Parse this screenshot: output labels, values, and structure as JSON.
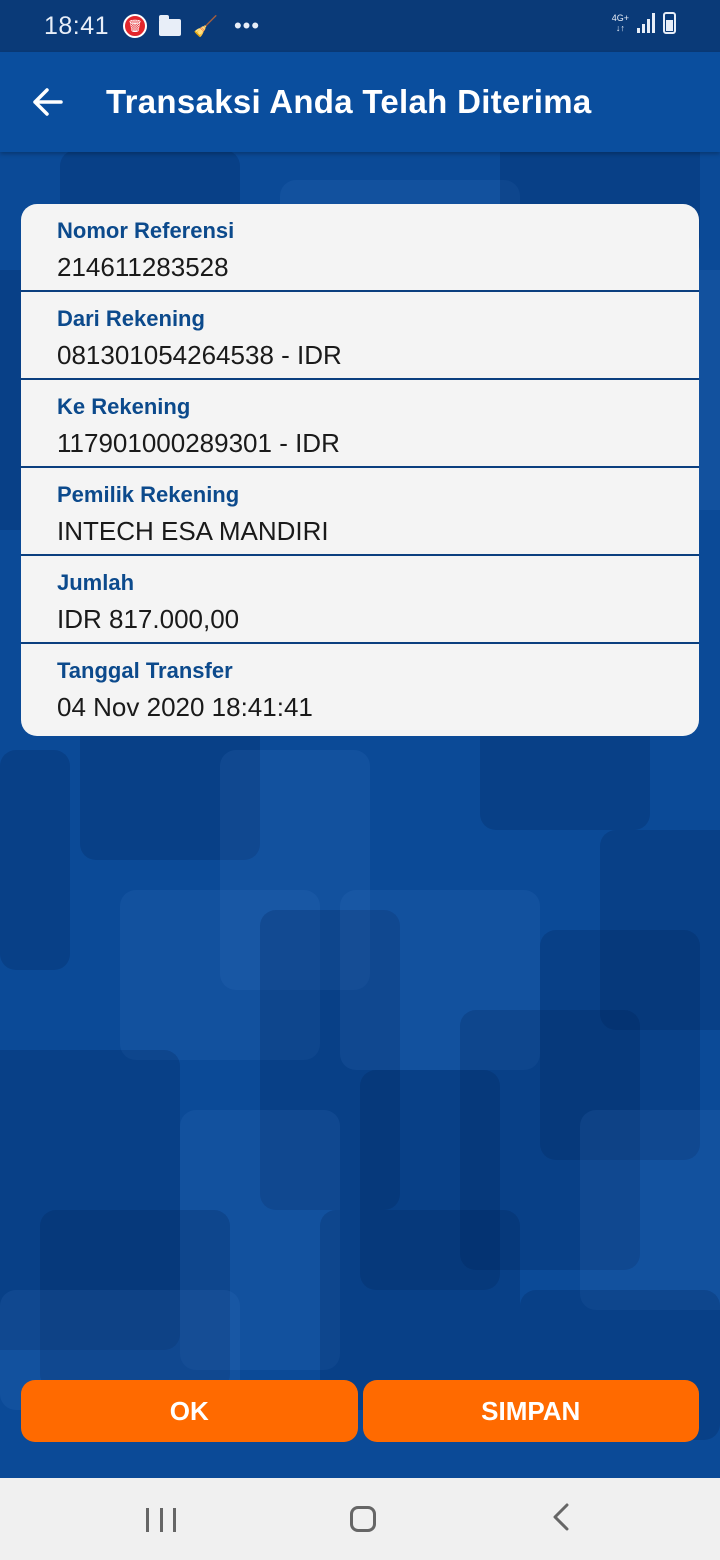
{
  "status_bar": {
    "time": "18:41",
    "network": "4G+"
  },
  "app_bar": {
    "back_icon": "arrow-left-icon",
    "title": "Transaksi Anda Telah Diterima"
  },
  "details": [
    {
      "label": "Nomor Referensi",
      "value": "214611283528"
    },
    {
      "label": "Dari Rekening",
      "value": "081301054264538 - IDR"
    },
    {
      "label": "Ke Rekening",
      "value": "117901000289301 - IDR"
    },
    {
      "label": "Pemilik Rekening",
      "value": "INTECH ESA MANDIRI"
    },
    {
      "label": "Jumlah",
      "value": "IDR 817.000,00"
    },
    {
      "label": "Tanggal Transfer",
      "value": "04 Nov 2020 18:41:41"
    }
  ],
  "actions": {
    "ok_label": "OK",
    "save_label": "SIMPAN"
  },
  "colors": {
    "primary": "#0a4e9e",
    "accent": "#ff6a00",
    "label": "#0c4a8c"
  }
}
